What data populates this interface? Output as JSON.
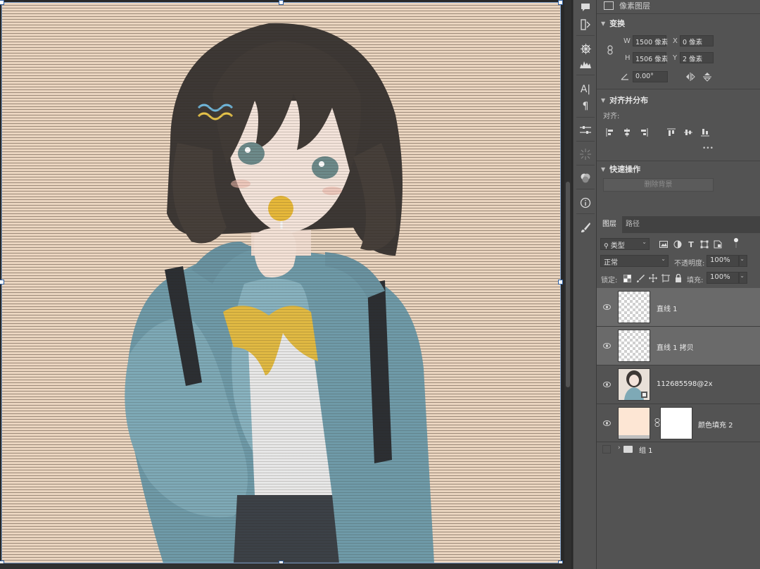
{
  "properties": {
    "header": "像素图层",
    "transform": {
      "title": "变换",
      "w_label": "W",
      "w_value": "1500 像素",
      "h_label": "H",
      "h_value": "1506 像素",
      "x_label": "X",
      "x_value": "0 像素",
      "y_label": "Y",
      "y_value": "2 像素",
      "angle_value": "0.00°"
    },
    "align": {
      "title": "对齐并分布",
      "align_label": "对齐:",
      "more": "•••"
    },
    "quick_actions": {
      "title": "快速操作",
      "remove_bg_label": "删除背景"
    }
  },
  "layers_panel": {
    "tabs": [
      "图层",
      "路径"
    ],
    "filter_label": "类型",
    "blend_mode": "正常",
    "opacity_label": "不透明度:",
    "opacity_value": "100%",
    "lock_label": "锁定:",
    "fill_label": "填充:",
    "fill_value": "100%",
    "layers": [
      {
        "name": "直线 1",
        "selected": true,
        "thumb": "checker"
      },
      {
        "name": "直线 1 拷贝",
        "selected": true,
        "thumb": "checker"
      },
      {
        "name": "112685598@2x",
        "selected": false,
        "thumb": "image"
      },
      {
        "name": "颜色填充 2",
        "selected": false,
        "thumb": "fill"
      }
    ],
    "group": {
      "name": "组 1"
    }
  },
  "colors": {
    "canvas_bg": "#ead5c0",
    "selection": "#2f5f9f",
    "fill_layer": "#fde6d4"
  }
}
